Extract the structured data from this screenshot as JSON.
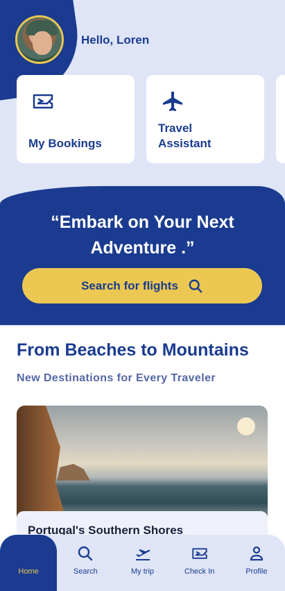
{
  "header": {
    "greeting": "Hello, Loren"
  },
  "quick_actions": [
    {
      "label": "My Bookings",
      "icon": "ticket-icon"
    },
    {
      "label": "Travel\nAssistant",
      "icon": "airplane-icon"
    }
  ],
  "hero": {
    "quote": "“Embark on Your Next\nAdventure .”",
    "search_label": "Search for flights"
  },
  "section": {
    "title": "From Beaches to Mountains",
    "subtitle": "New Destinations for Every Traveler"
  },
  "destination": {
    "title": "Portugal's Southern Shores"
  },
  "nav": {
    "items": [
      {
        "label": "Home",
        "icon": "home-icon",
        "active": true
      },
      {
        "label": "Search",
        "icon": "search-icon"
      },
      {
        "label": "My trip",
        "icon": "departure-icon"
      },
      {
        "label": "Check In",
        "icon": "ticket-icon"
      },
      {
        "label": "Profile",
        "icon": "user-icon"
      }
    ]
  },
  "colors": {
    "primary": "#1a3b8f",
    "accent": "#ecc853",
    "background": "#dfe5f7"
  }
}
